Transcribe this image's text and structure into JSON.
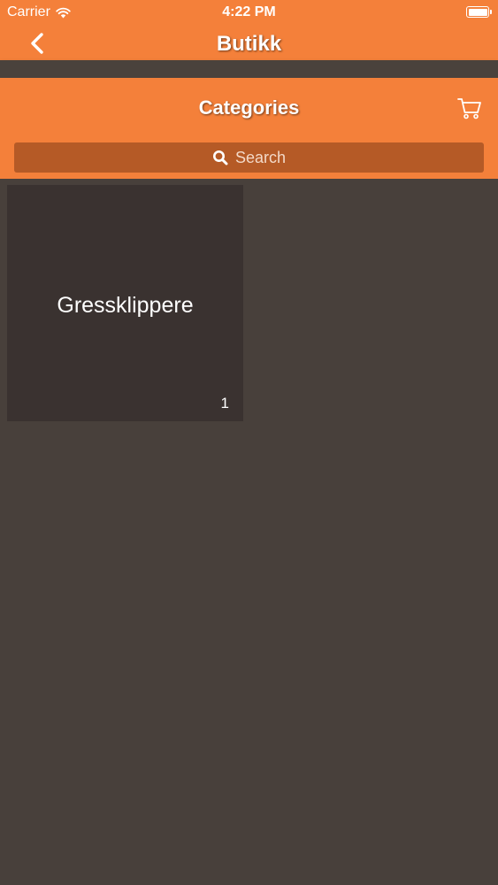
{
  "status_bar": {
    "carrier": "Carrier",
    "time": "4:22 PM"
  },
  "nav": {
    "title": "Butikk"
  },
  "header": {
    "title": "Categories"
  },
  "search": {
    "placeholder": "Search"
  },
  "categories": [
    {
      "name": "Gressklippere",
      "count": "1"
    }
  ],
  "colors": {
    "accent": "#f4803a",
    "search_bg": "#b55a26",
    "background": "#48403b",
    "tile_bg": "#3a3230"
  }
}
